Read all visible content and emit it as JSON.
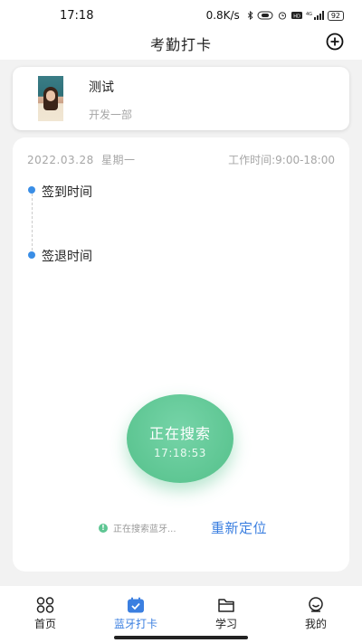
{
  "status_bar": {
    "time": "17:18",
    "network_speed": "0.8K/s",
    "battery": "92",
    "icons": [
      "bluetooth-icon",
      "vibrate-icon",
      "alarm-icon",
      "hd-icon",
      "4g-signal-icon",
      "battery-icon"
    ]
  },
  "header": {
    "title": "考勤打卡",
    "add_icon": "plus-circle-icon"
  },
  "profile": {
    "name": "测试",
    "department": "开发一部"
  },
  "attendance": {
    "date": "2022.03.28",
    "weekday": "星期一",
    "work_hours": "工作时间:9:00-18:00",
    "check_in_label": "签到时间",
    "check_out_label": "签退时间"
  },
  "search_button": {
    "title": "正在搜索",
    "time": "17:18:53"
  },
  "bluetooth": {
    "status_text": "正在搜索蓝牙...",
    "relocate_label": "重新定位"
  },
  "colors": {
    "accent_blue": "#3b7fe0",
    "search_green": "#5ec693",
    "timeline_dot": "#3a8ee6"
  },
  "bottom_nav": {
    "items": [
      {
        "label": "首页",
        "icon": "home-grid-icon",
        "active": false
      },
      {
        "label": "蓝牙打卡",
        "icon": "calendar-check-icon",
        "active": true
      },
      {
        "label": "学习",
        "icon": "folder-icon",
        "active": false
      },
      {
        "label": "我的",
        "icon": "smile-user-icon",
        "active": false
      }
    ]
  }
}
